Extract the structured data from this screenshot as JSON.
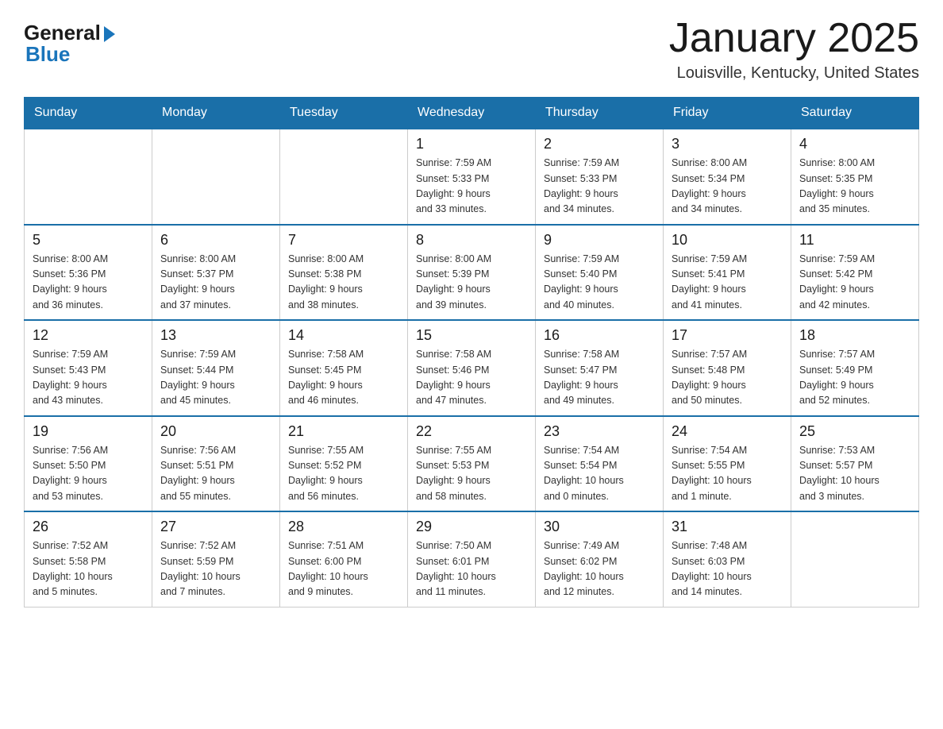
{
  "header": {
    "logo_general": "General",
    "logo_blue": "Blue",
    "month_title": "January 2025",
    "location": "Louisville, Kentucky, United States"
  },
  "days_of_week": [
    "Sunday",
    "Monday",
    "Tuesday",
    "Wednesday",
    "Thursday",
    "Friday",
    "Saturday"
  ],
  "weeks": [
    [
      {
        "day": "",
        "info": ""
      },
      {
        "day": "",
        "info": ""
      },
      {
        "day": "",
        "info": ""
      },
      {
        "day": "1",
        "info": "Sunrise: 7:59 AM\nSunset: 5:33 PM\nDaylight: 9 hours\nand 33 minutes."
      },
      {
        "day": "2",
        "info": "Sunrise: 7:59 AM\nSunset: 5:33 PM\nDaylight: 9 hours\nand 34 minutes."
      },
      {
        "day": "3",
        "info": "Sunrise: 8:00 AM\nSunset: 5:34 PM\nDaylight: 9 hours\nand 34 minutes."
      },
      {
        "day": "4",
        "info": "Sunrise: 8:00 AM\nSunset: 5:35 PM\nDaylight: 9 hours\nand 35 minutes."
      }
    ],
    [
      {
        "day": "5",
        "info": "Sunrise: 8:00 AM\nSunset: 5:36 PM\nDaylight: 9 hours\nand 36 minutes."
      },
      {
        "day": "6",
        "info": "Sunrise: 8:00 AM\nSunset: 5:37 PM\nDaylight: 9 hours\nand 37 minutes."
      },
      {
        "day": "7",
        "info": "Sunrise: 8:00 AM\nSunset: 5:38 PM\nDaylight: 9 hours\nand 38 minutes."
      },
      {
        "day": "8",
        "info": "Sunrise: 8:00 AM\nSunset: 5:39 PM\nDaylight: 9 hours\nand 39 minutes."
      },
      {
        "day": "9",
        "info": "Sunrise: 7:59 AM\nSunset: 5:40 PM\nDaylight: 9 hours\nand 40 minutes."
      },
      {
        "day": "10",
        "info": "Sunrise: 7:59 AM\nSunset: 5:41 PM\nDaylight: 9 hours\nand 41 minutes."
      },
      {
        "day": "11",
        "info": "Sunrise: 7:59 AM\nSunset: 5:42 PM\nDaylight: 9 hours\nand 42 minutes."
      }
    ],
    [
      {
        "day": "12",
        "info": "Sunrise: 7:59 AM\nSunset: 5:43 PM\nDaylight: 9 hours\nand 43 minutes."
      },
      {
        "day": "13",
        "info": "Sunrise: 7:59 AM\nSunset: 5:44 PM\nDaylight: 9 hours\nand 45 minutes."
      },
      {
        "day": "14",
        "info": "Sunrise: 7:58 AM\nSunset: 5:45 PM\nDaylight: 9 hours\nand 46 minutes."
      },
      {
        "day": "15",
        "info": "Sunrise: 7:58 AM\nSunset: 5:46 PM\nDaylight: 9 hours\nand 47 minutes."
      },
      {
        "day": "16",
        "info": "Sunrise: 7:58 AM\nSunset: 5:47 PM\nDaylight: 9 hours\nand 49 minutes."
      },
      {
        "day": "17",
        "info": "Sunrise: 7:57 AM\nSunset: 5:48 PM\nDaylight: 9 hours\nand 50 minutes."
      },
      {
        "day": "18",
        "info": "Sunrise: 7:57 AM\nSunset: 5:49 PM\nDaylight: 9 hours\nand 52 minutes."
      }
    ],
    [
      {
        "day": "19",
        "info": "Sunrise: 7:56 AM\nSunset: 5:50 PM\nDaylight: 9 hours\nand 53 minutes."
      },
      {
        "day": "20",
        "info": "Sunrise: 7:56 AM\nSunset: 5:51 PM\nDaylight: 9 hours\nand 55 minutes."
      },
      {
        "day": "21",
        "info": "Sunrise: 7:55 AM\nSunset: 5:52 PM\nDaylight: 9 hours\nand 56 minutes."
      },
      {
        "day": "22",
        "info": "Sunrise: 7:55 AM\nSunset: 5:53 PM\nDaylight: 9 hours\nand 58 minutes."
      },
      {
        "day": "23",
        "info": "Sunrise: 7:54 AM\nSunset: 5:54 PM\nDaylight: 10 hours\nand 0 minutes."
      },
      {
        "day": "24",
        "info": "Sunrise: 7:54 AM\nSunset: 5:55 PM\nDaylight: 10 hours\nand 1 minute."
      },
      {
        "day": "25",
        "info": "Sunrise: 7:53 AM\nSunset: 5:57 PM\nDaylight: 10 hours\nand 3 minutes."
      }
    ],
    [
      {
        "day": "26",
        "info": "Sunrise: 7:52 AM\nSunset: 5:58 PM\nDaylight: 10 hours\nand 5 minutes."
      },
      {
        "day": "27",
        "info": "Sunrise: 7:52 AM\nSunset: 5:59 PM\nDaylight: 10 hours\nand 7 minutes."
      },
      {
        "day": "28",
        "info": "Sunrise: 7:51 AM\nSunset: 6:00 PM\nDaylight: 10 hours\nand 9 minutes."
      },
      {
        "day": "29",
        "info": "Sunrise: 7:50 AM\nSunset: 6:01 PM\nDaylight: 10 hours\nand 11 minutes."
      },
      {
        "day": "30",
        "info": "Sunrise: 7:49 AM\nSunset: 6:02 PM\nDaylight: 10 hours\nand 12 minutes."
      },
      {
        "day": "31",
        "info": "Sunrise: 7:48 AM\nSunset: 6:03 PM\nDaylight: 10 hours\nand 14 minutes."
      },
      {
        "day": "",
        "info": ""
      }
    ]
  ]
}
